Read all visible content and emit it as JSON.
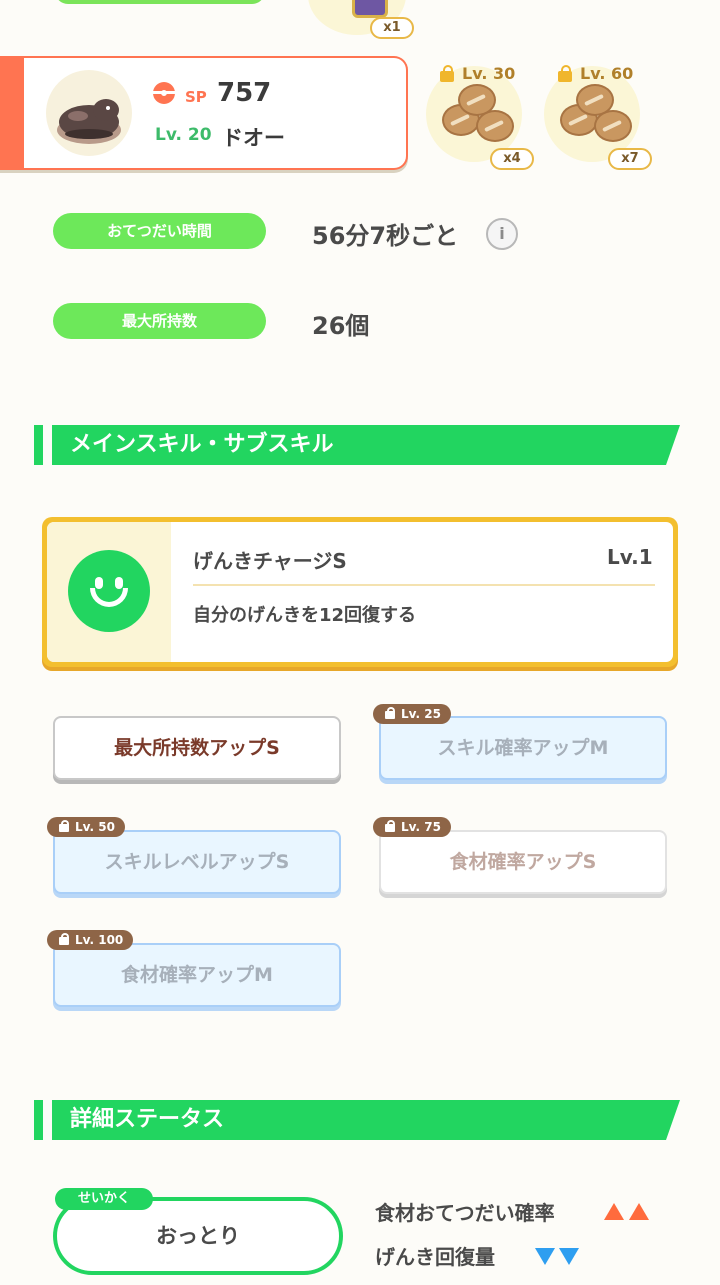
{
  "top": {
    "item_qty": "x1"
  },
  "pokemon": {
    "sp_label": "SP",
    "sp_value": "757",
    "level": "Lv. 20",
    "name": "ドオー"
  },
  "ingredients": [
    {
      "unlock": "Lv. 30",
      "qty": "x4"
    },
    {
      "unlock": "Lv. 60",
      "qty": "x7"
    }
  ],
  "info": [
    {
      "label": "おてつだい時間",
      "value": "56分7秒ごと"
    },
    {
      "label": "最大所持数",
      "value": "26個"
    }
  ],
  "skills_section": {
    "title": "メインスキル・サブスキル",
    "main_skill": {
      "name": "げんきチャージS",
      "level": "Lv.1",
      "description": "自分のげんきを12回復する"
    },
    "sub_skills": [
      {
        "name": "最大所持数アップS",
        "unlock": ""
      },
      {
        "name": "スキル確率アップM",
        "unlock": "Lv. 25"
      },
      {
        "name": "スキルレベルアップS",
        "unlock": "Lv. 50"
      },
      {
        "name": "食材確率アップS",
        "unlock": "Lv. 75"
      },
      {
        "name": "食材確率アップM",
        "unlock": "Lv. 100"
      }
    ]
  },
  "detail_section": {
    "title": "詳細ステータス",
    "nature_tag": "せいかく",
    "nature": "おっとり",
    "effects": [
      {
        "label": "食材おてつだい確率",
        "direction": "up"
      },
      {
        "label": "げんき回復量",
        "direction": "down"
      }
    ]
  },
  "colors": {
    "accent_green": "#22d560",
    "pill_green": "#6de85a",
    "sp_orange": "#ff7451",
    "gold": "#f3bf2f",
    "up_arrow": "#ff6b3d",
    "down_arrow": "#2e9ef0"
  }
}
